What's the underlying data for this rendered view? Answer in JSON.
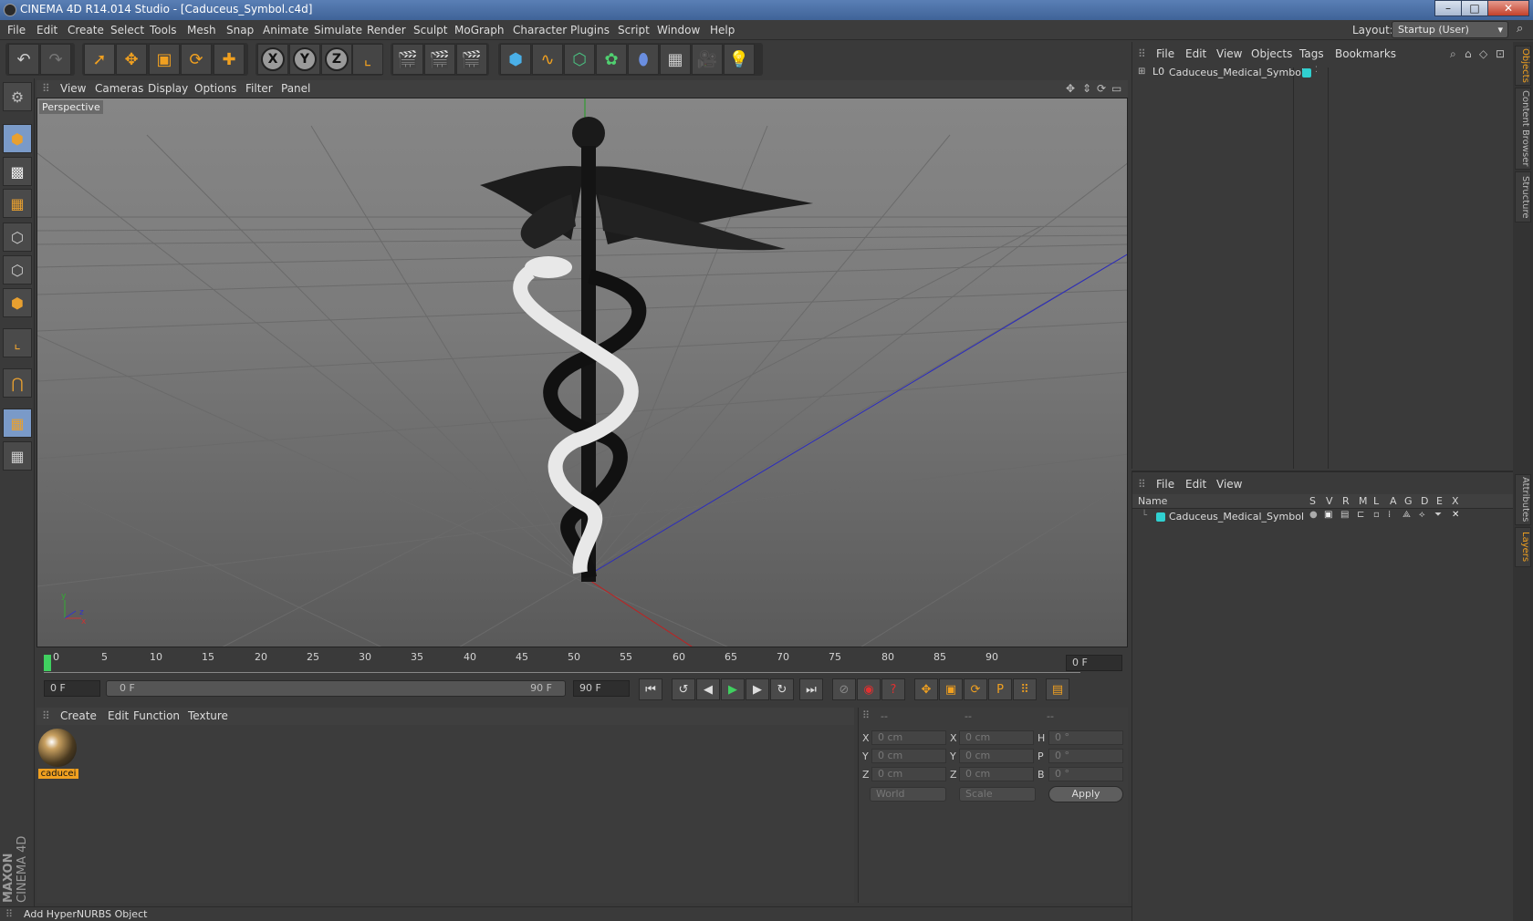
{
  "window": {
    "title": "CINEMA 4D R14.014 Studio - [Caduceus_Symbol.c4d]",
    "min": "–",
    "max": "□",
    "close": "✕"
  },
  "menubar": [
    "File",
    "Edit",
    "Create",
    "Select",
    "Tools",
    "Mesh",
    "Snap",
    "Animate",
    "Simulate",
    "Render",
    "Sculpt",
    "MoGraph",
    "Character",
    "Plugins",
    "Script",
    "Window",
    "Help"
  ],
  "layout": {
    "label": "Layout:",
    "value": "Startup (User)"
  },
  "viewport": {
    "menu": [
      "View",
      "Cameras",
      "Display",
      "Options",
      "Filter",
      "Panel"
    ],
    "label": "Perspective"
  },
  "timeline": {
    "ticks": [
      "0",
      "5",
      "10",
      "15",
      "20",
      "25",
      "30",
      "35",
      "40",
      "45",
      "50",
      "55",
      "60",
      "65",
      "70",
      "75",
      "80",
      "85",
      "90"
    ],
    "frame_field": "0 F",
    "start": "0 F",
    "range_start": "0 F",
    "range_end": "90 F",
    "end": "90 F"
  },
  "materials": {
    "menu": [
      "Create",
      "Edit",
      "Function",
      "Texture"
    ],
    "items": [
      {
        "name": "caducei"
      }
    ]
  },
  "coords": {
    "rows": [
      {
        "a": "X",
        "av": "0 cm",
        "b": "X",
        "bv": "0 cm",
        "c": "H",
        "cv": "0 °"
      },
      {
        "a": "Y",
        "av": "0 cm",
        "b": "Y",
        "bv": "0 cm",
        "c": "P",
        "cv": "0 °"
      },
      {
        "a": "Z",
        "av": "0 cm",
        "b": "Z",
        "bv": "0 cm",
        "c": "B",
        "cv": "0 °"
      }
    ],
    "header": [
      "--",
      "--",
      "--"
    ],
    "world": "World",
    "scale": "Scale",
    "apply": "Apply"
  },
  "status": "Add HyperNURBS Object",
  "objects": {
    "menu": [
      "File",
      "Edit",
      "View",
      "Objects",
      "Tags",
      "Bookmarks"
    ],
    "item": "Caduceus_Medical_Symbol"
  },
  "layers": {
    "menu": [
      "File",
      "Edit",
      "View"
    ],
    "name_header": "Name",
    "cols": [
      "S",
      "V",
      "R",
      "M",
      "L",
      "A",
      "G",
      "D",
      "E",
      "X"
    ],
    "item": "Caduceus_Medical_Symbol"
  },
  "side_tabs": [
    "Objects",
    "Content Browser",
    "Structure",
    "Attributes",
    "Layers"
  ],
  "branding": {
    "maxon": "MAXON",
    "c4d": "CINEMA 4D"
  }
}
